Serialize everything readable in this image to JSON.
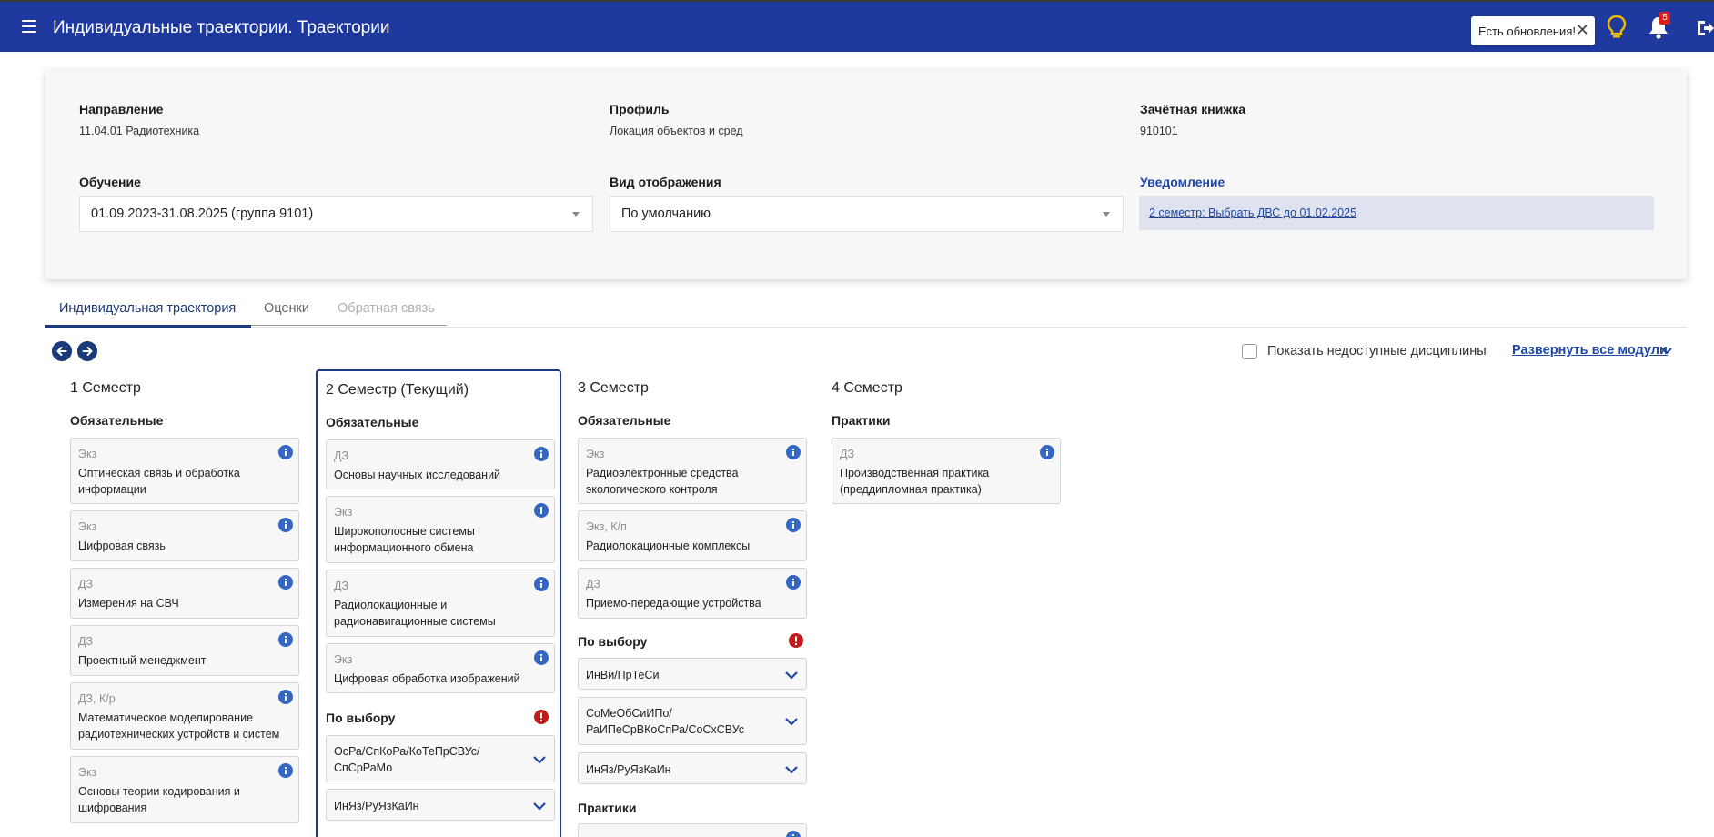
{
  "header": {
    "title": "Индивидуальные траектории. Траектории",
    "update_label": "Есть обновления!",
    "close_glyph": "✕",
    "notifications_count": "5",
    "colors": {
      "bar": "#1e3a9f",
      "bulb": "#f2b900",
      "badge": "#d81f1f"
    }
  },
  "info": {
    "direction_label": "Направление",
    "direction_value": "11.04.01 Радиотехника",
    "profile_label": "Профиль",
    "profile_value": "Локация объектов и сред",
    "gradebook_label": "Зачётная книжка",
    "gradebook_value": "910101",
    "study_label": "Обучение",
    "study_value": "01.09.2023-31.08.2025 (группа 9101)",
    "view_label": "Вид отображения",
    "view_value": "По умолчанию",
    "notice_label": "Уведомление",
    "notice_value": "2 семестр: Выбрать ДВС до 01.02.2025"
  },
  "tabs": [
    "Индивидуальная траектория",
    "Оценки",
    "Обратная связь"
  ],
  "toolbar": {
    "show_unavailable": "Показать недоступные дисциплины",
    "expand_all": "Развернуть все модули"
  },
  "semesters": [
    {
      "title": "1 Семестр",
      "required_label": "Обязательные",
      "courses": [
        {
          "type": "Экз",
          "name": "Оптическая связь и обработка информации"
        },
        {
          "type": "Экз",
          "name": "Цифровая связь"
        },
        {
          "type": "ДЗ",
          "name": "Измерения на СВЧ"
        },
        {
          "type": "ДЗ",
          "name": "Проектный менеджмент"
        },
        {
          "type": "ДЗ, К/р",
          "name": "Математическое моделирование радиотехнических устройств и систем"
        },
        {
          "type": "Экз",
          "name": "Основы теории кодирования и шифрования"
        }
      ]
    },
    {
      "title": "2 Семестр (Текущий)",
      "required_label": "Обязательные",
      "courses": [
        {
          "type": "ДЗ",
          "name": "Основы научных исследований"
        },
        {
          "type": "Экз",
          "name": "Широкополосные системы информационного обмена"
        },
        {
          "type": "ДЗ",
          "name": "Радиолокационные и радионавигационные системы"
        },
        {
          "type": "Экз",
          "name": "Цифровая обработка изображений"
        }
      ],
      "elective_label": "По выбору",
      "electives": [
        "ОсРа/СпКоРа/КоТеПрСВУс/СпСрРаМо",
        "ИнЯз/РуЯзКаИн"
      ]
    },
    {
      "title": "3 Семестр",
      "required_label": "Обязательные",
      "courses": [
        {
          "type": "Экз",
          "name": "Радиоэлектронные средства экологического контроля"
        },
        {
          "type": "Экз, К/п",
          "name": "Радиолокационные комплексы"
        },
        {
          "type": "ДЗ",
          "name": "Приемо-передающие устройства"
        }
      ],
      "elective_label": "По выбору",
      "electives": [
        "ИнВи/ПрТеСи",
        "СоМеОбСиИПо/РаИПеСрВКоСпРа/СоСхСВУс",
        "ИнЯз/РуЯзКаИн"
      ],
      "practice_label": "Практики"
    },
    {
      "title": "4 Семестр",
      "practice_label": "Практики",
      "courses": [
        {
          "type": "ДЗ",
          "name": "Производственная практика (преддипломная практика)"
        }
      ]
    }
  ]
}
